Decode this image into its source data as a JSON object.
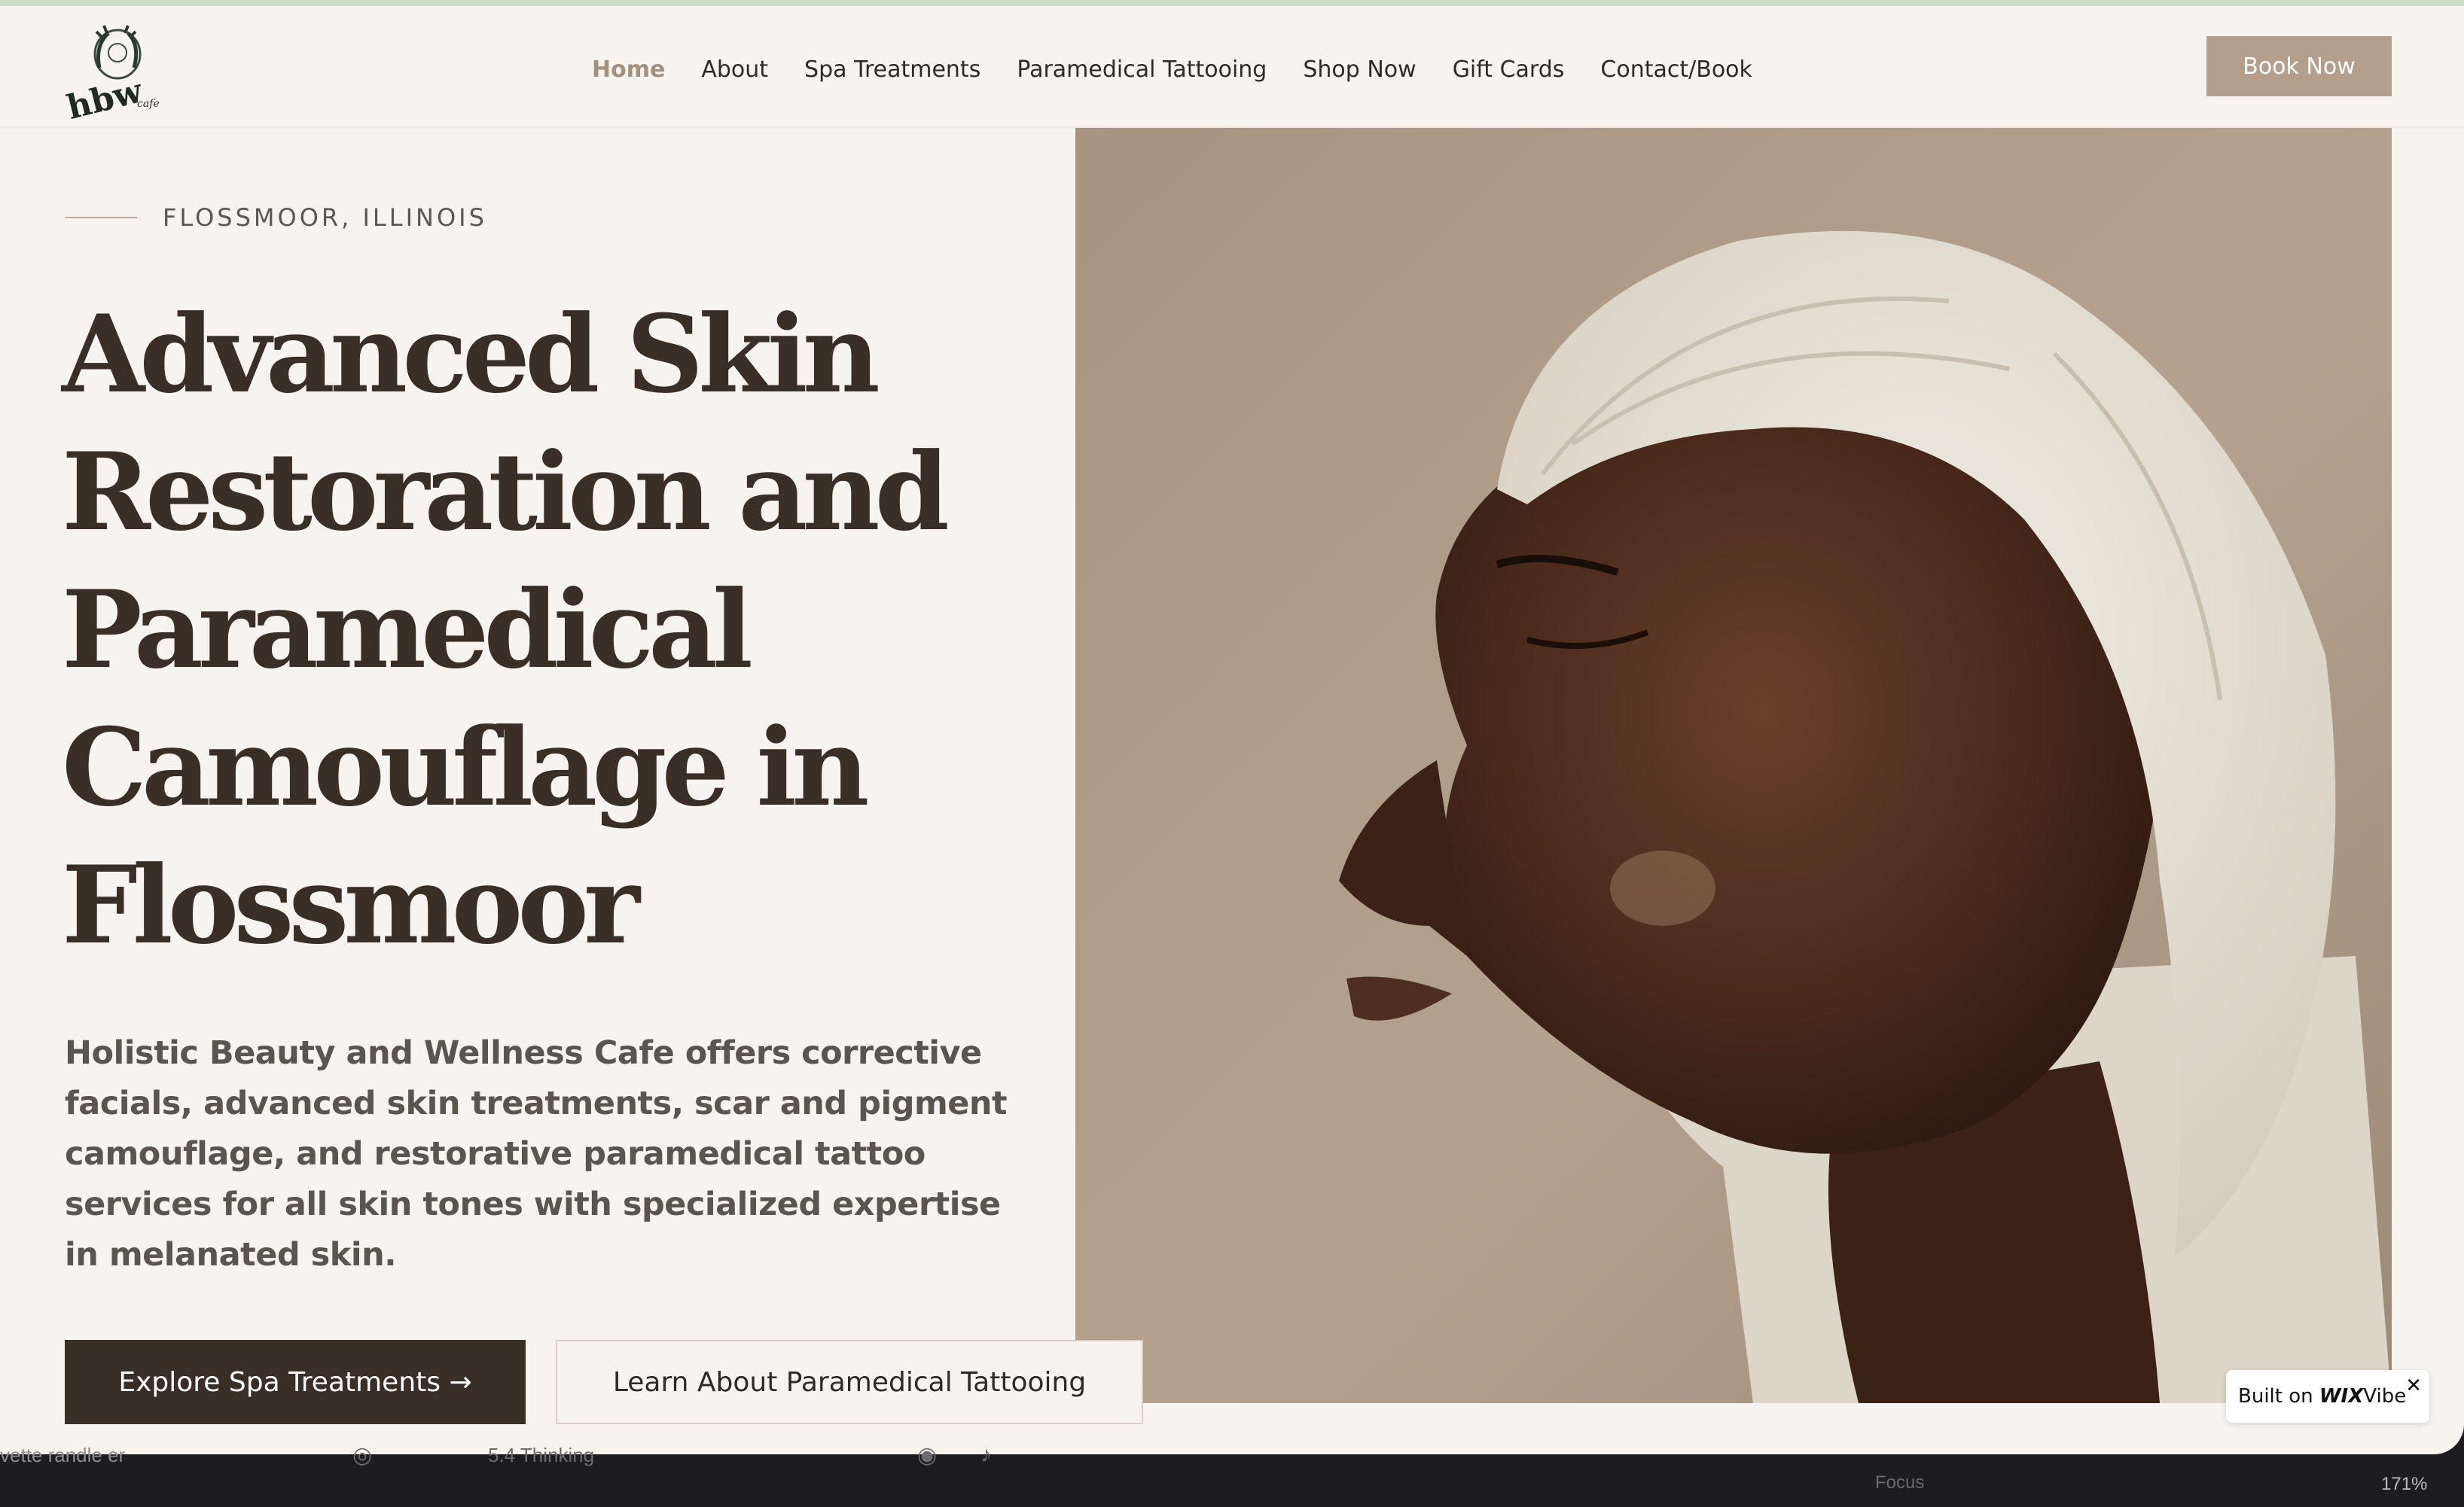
{
  "header": {
    "logo_icon": "hbw-cafe-logo",
    "nav": [
      {
        "label": "Home",
        "active": true
      },
      {
        "label": "About"
      },
      {
        "label": "Spa Treatments"
      },
      {
        "label": "Paramedical Tattooing"
      },
      {
        "label": "Shop Now"
      },
      {
        "label": "Gift Cards"
      },
      {
        "label": "Contact/Book"
      }
    ],
    "book_now": "Book Now"
  },
  "hero": {
    "eyebrow": "FLOSSMOOR, ILLINOIS",
    "headline": "Advanced Skin Restoration and Paramedical Camouflage in Flossmoor",
    "description": "Holistic Beauty and Wellness Cafe offers corrective facials, advanced skin treatments, scar and pigment camouflage, and restorative paramedical tattoo services for all skin tones with specialized expertise in melanated skin.",
    "primary_cta": "Explore Spa Treatments →",
    "secondary_cta": "Learn About Paramedical Tattooing",
    "image_icon": "woman-with-towel-photo"
  },
  "badge": {
    "prefix": "Built on ",
    "brand": "WIX",
    "suffix": "Vibe",
    "close": "✕"
  },
  "os": {
    "left_text": "vette randle er",
    "status": "5.4 Thinking",
    "focus": "Focus",
    "zoom": "171%"
  },
  "colors": {
    "page_bg": "#f7f4f0",
    "accent": "#b39f8c",
    "active_nav": "#a3907d",
    "heading": "#3a2f27",
    "dark_button": "#3a2f27"
  }
}
